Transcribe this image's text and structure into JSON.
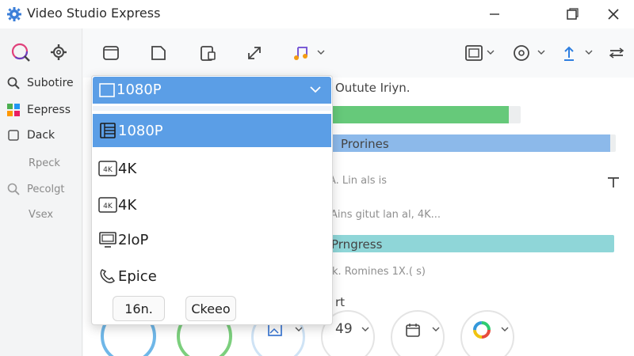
{
  "window": {
    "title": "Video Studio Express"
  },
  "sidebar": {
    "items": [
      {
        "label": "Subotire"
      },
      {
        "label": "Eepress"
      },
      {
        "label": "Dack"
      },
      {
        "label": "Rpeck"
      },
      {
        "label": "Pecolgt"
      },
      {
        "label": "Vsex"
      }
    ]
  },
  "main": {
    "header_text": "Outute  Iriyn.",
    "row1": {
      "progress": 0.94
    },
    "row2": {
      "label": "Prorines",
      "progress": 0.98
    },
    "row3": {
      "text": "A. Lin als is"
    },
    "row4": {
      "text": "Ains gitut lan al, 4K..."
    },
    "row5": {
      "label": "Prngress",
      "progress": 1.0
    },
    "row6": {
      "text": "k.  Romines 1X.( s)"
    },
    "row7": {
      "text": "rt"
    },
    "bottom_value": "49"
  },
  "dropdown": {
    "selected_label": "1080P",
    "options": [
      {
        "label": "1080P",
        "icon": "film-icon",
        "selected": true
      },
      {
        "label": "4K",
        "icon": "4k-icon",
        "selected": false
      },
      {
        "label": "4K",
        "icon": "4k-icon",
        "selected": false
      },
      {
        "label": "2loP",
        "icon": "monitor-icon",
        "selected": false
      },
      {
        "label": "Epice",
        "icon": "phone-icon",
        "selected": false
      }
    ],
    "buttons": {
      "left": "16n.",
      "right": "Ckeeo"
    }
  },
  "colors": {
    "accent": "#5b9ee6",
    "green_bar": "#66c97a",
    "blue_bar": "#8cb9ea",
    "teal_bar": "#8fd6d8"
  }
}
